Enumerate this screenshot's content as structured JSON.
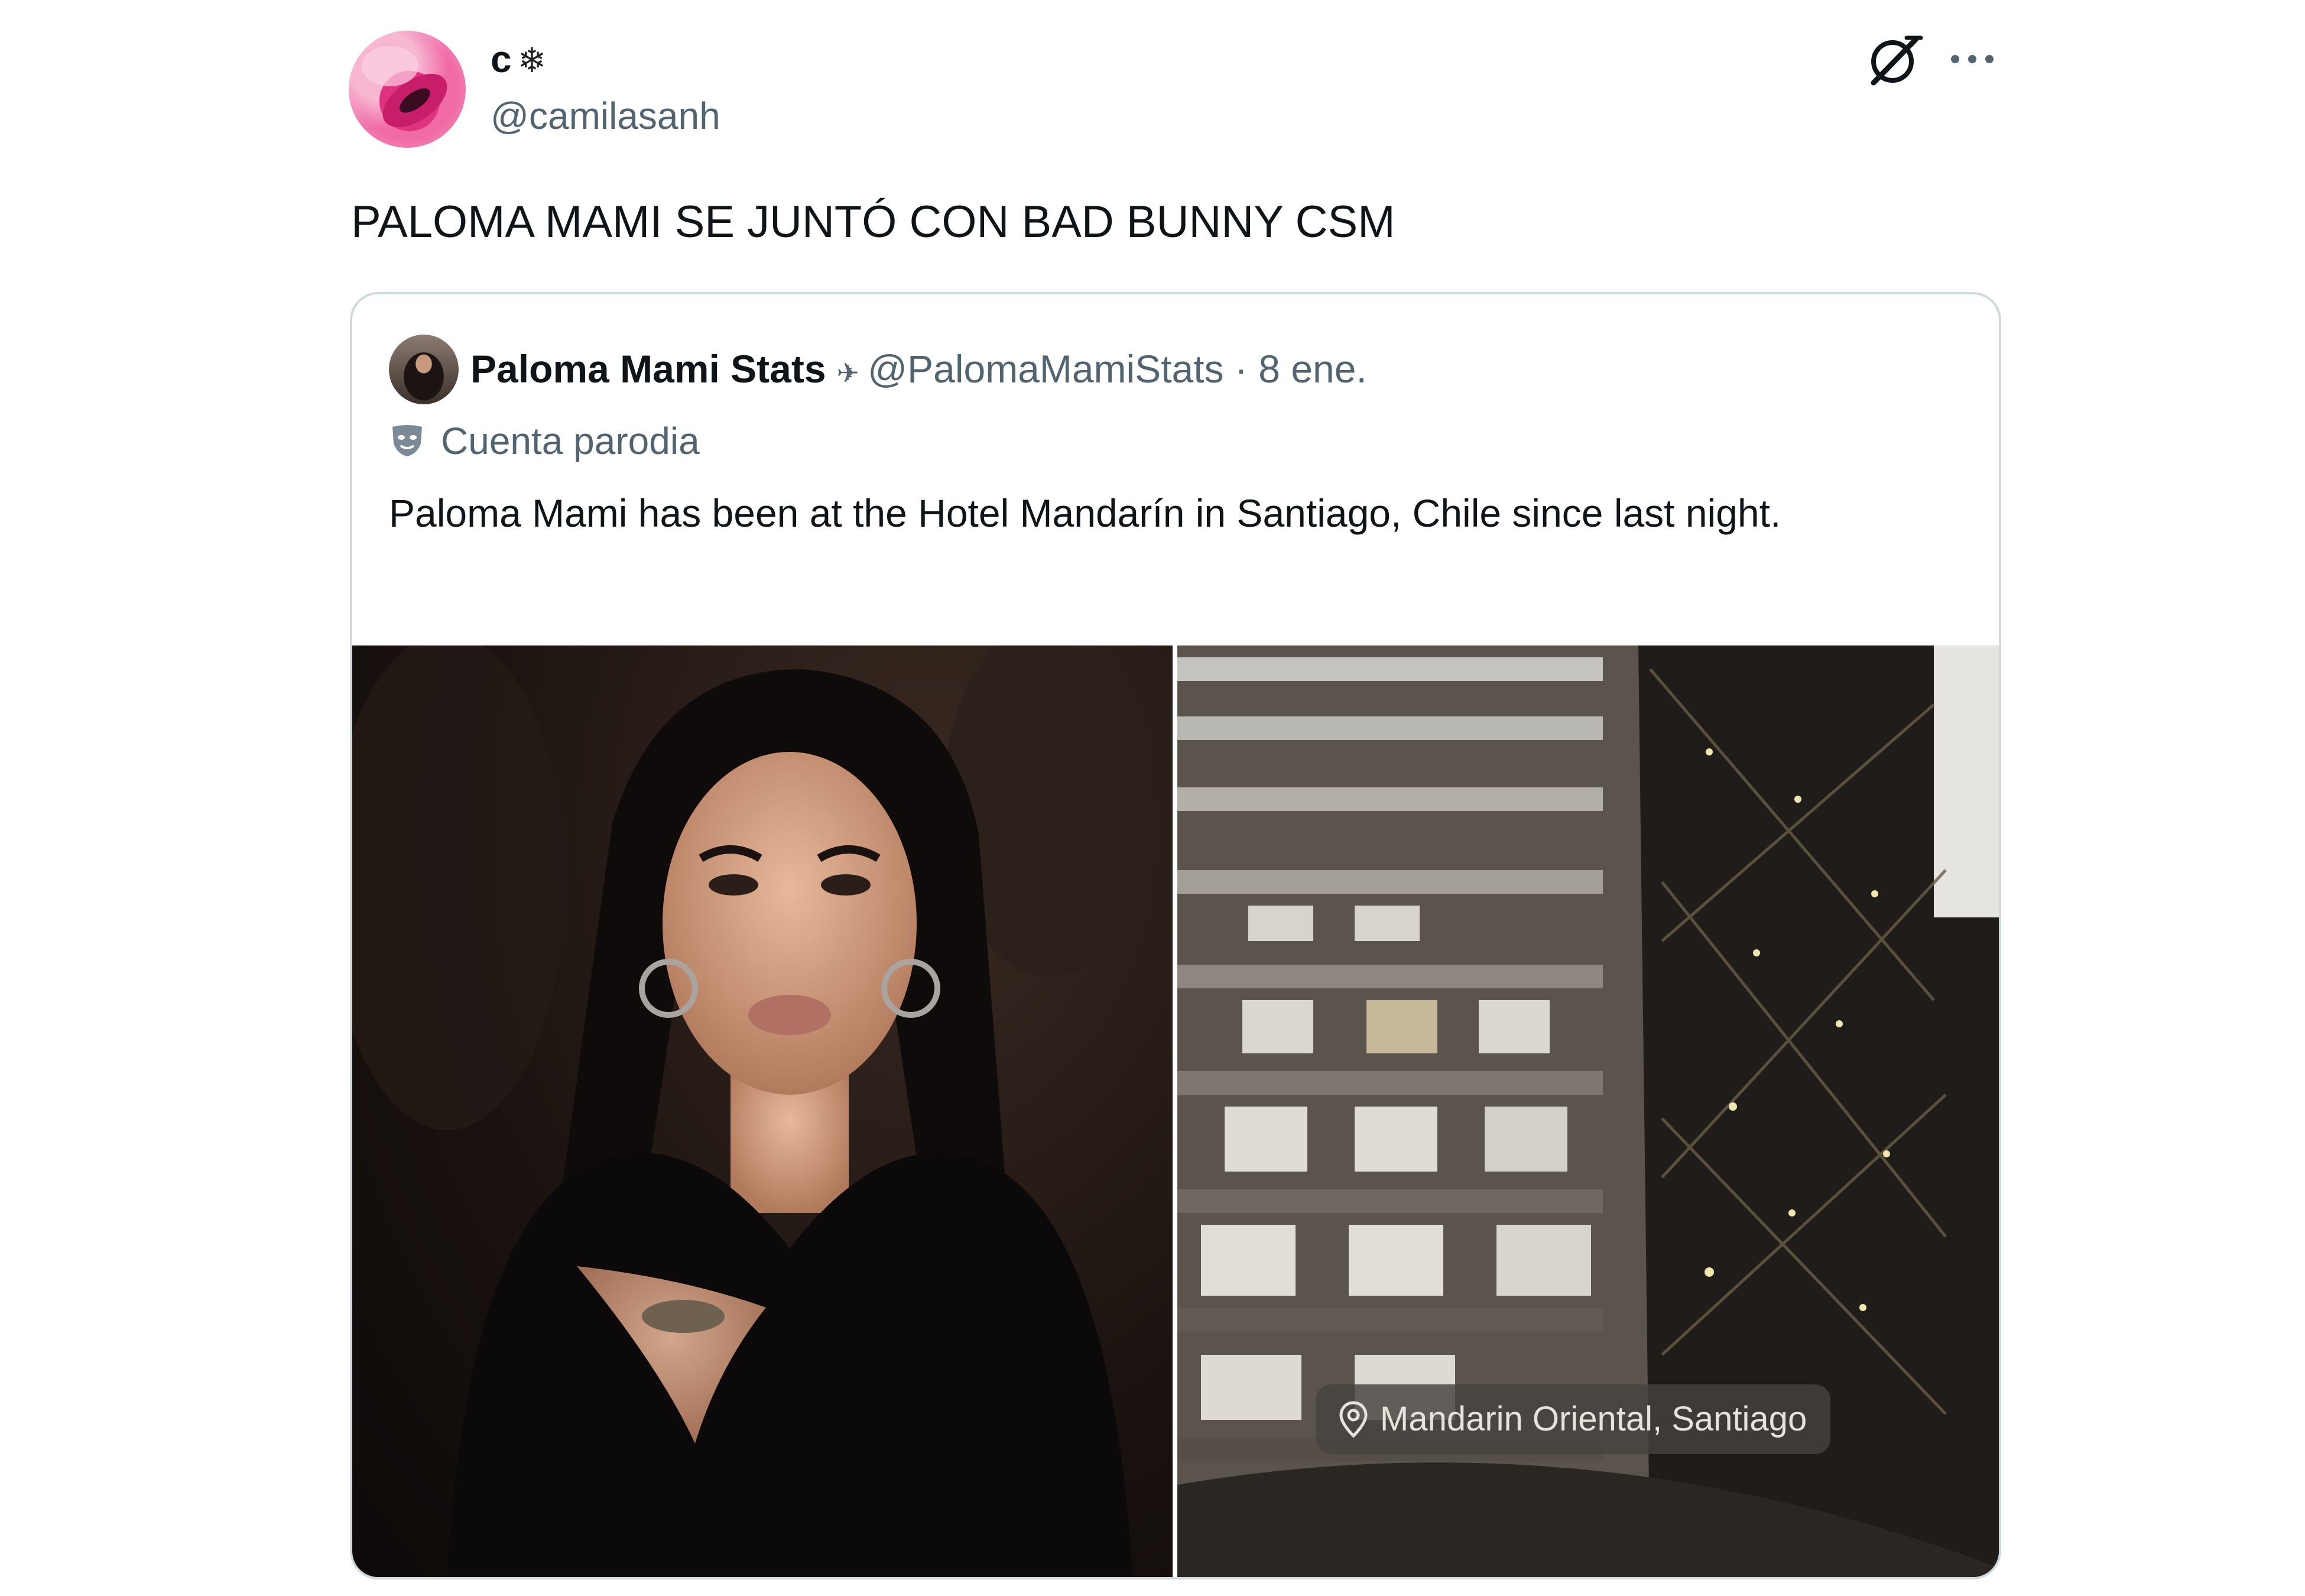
{
  "tweet": {
    "author": {
      "display_name": "c",
      "badge_glyph": "❄",
      "handle": "@camilasanh",
      "avatar": "pink-lips-avatar"
    },
    "icons": {
      "grok": "grok-icon",
      "more": "more-icon"
    },
    "text": "PALOMA MAMI SE JUNTÓ CON BAD BUNNY CSM",
    "quoted_tweet": {
      "display_name": "Paloma Mami Stats",
      "name_glyph": "✈",
      "handle": "@PalomaMamiStats",
      "separator": "·",
      "date": "8 ene.",
      "parody_label": "Cuenta parodia",
      "text": "Paloma Mami has been at the Hotel Mandarín in Santiago, Chile since last night.",
      "media": {
        "left_photo": "portrait-photo",
        "right_photo": "hotel-atrium-photo",
        "location_sticker": "Mandarin Oriental, Santiago"
      }
    }
  }
}
